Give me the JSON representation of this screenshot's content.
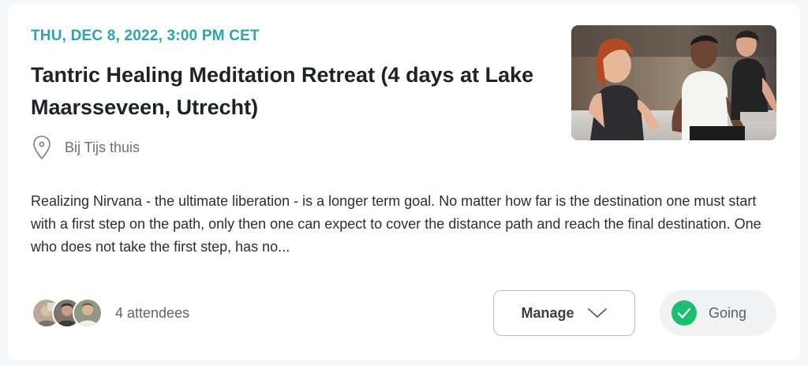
{
  "event": {
    "date": "THU, DEC 8, 2022, 3:00 PM CET",
    "title": "Tantric Healing Meditation Retreat (4 days at Lake Maarsseveen, Utrecht)",
    "location": "Bij Tijs thuis",
    "description": "Realizing Nirvana - the ultimate liberation - is a longer term goal. No matter how far is the destination one must start with a first step on the path, only then one can expect to cover the distance path and reach the final destination. One who does not take the first step, has no...",
    "attendees_label": "4 attendees"
  },
  "actions": {
    "manage_label": "Manage",
    "going_label": "Going"
  },
  "icons": {
    "location": "map-pin-icon",
    "manage": "chevron-down-icon",
    "going": "check-circle-icon"
  },
  "colors": {
    "date": "#2aa3b3",
    "going_check": "#19c06d"
  }
}
